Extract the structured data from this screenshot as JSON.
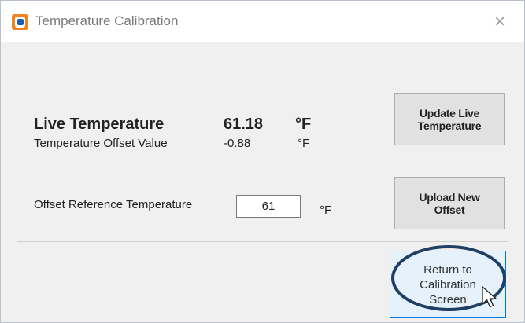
{
  "window": {
    "title": "Temperature Calibration",
    "close_label": "×"
  },
  "live": {
    "label": "Live Temperature",
    "value": "61.18",
    "unit": "°F"
  },
  "offset": {
    "label": "Temperature Offset Value",
    "value": "-0.88",
    "unit": "°F"
  },
  "reference": {
    "label": "Offset Reference Temperature",
    "value": "61",
    "unit": "°F"
  },
  "buttons": {
    "update_line1": "Update Live",
    "update_line2": "Temperature",
    "upload_line1": "Upload New",
    "upload_line2": "Offset",
    "return_line1": "Return to",
    "return_line2": "Calibration",
    "return_line3": "Screen"
  },
  "colors": {
    "accent": "#0078d7",
    "highlight_ring": "#1f3f63",
    "icon_orange": "#f0851f",
    "icon_blue": "#1f5ea8"
  }
}
